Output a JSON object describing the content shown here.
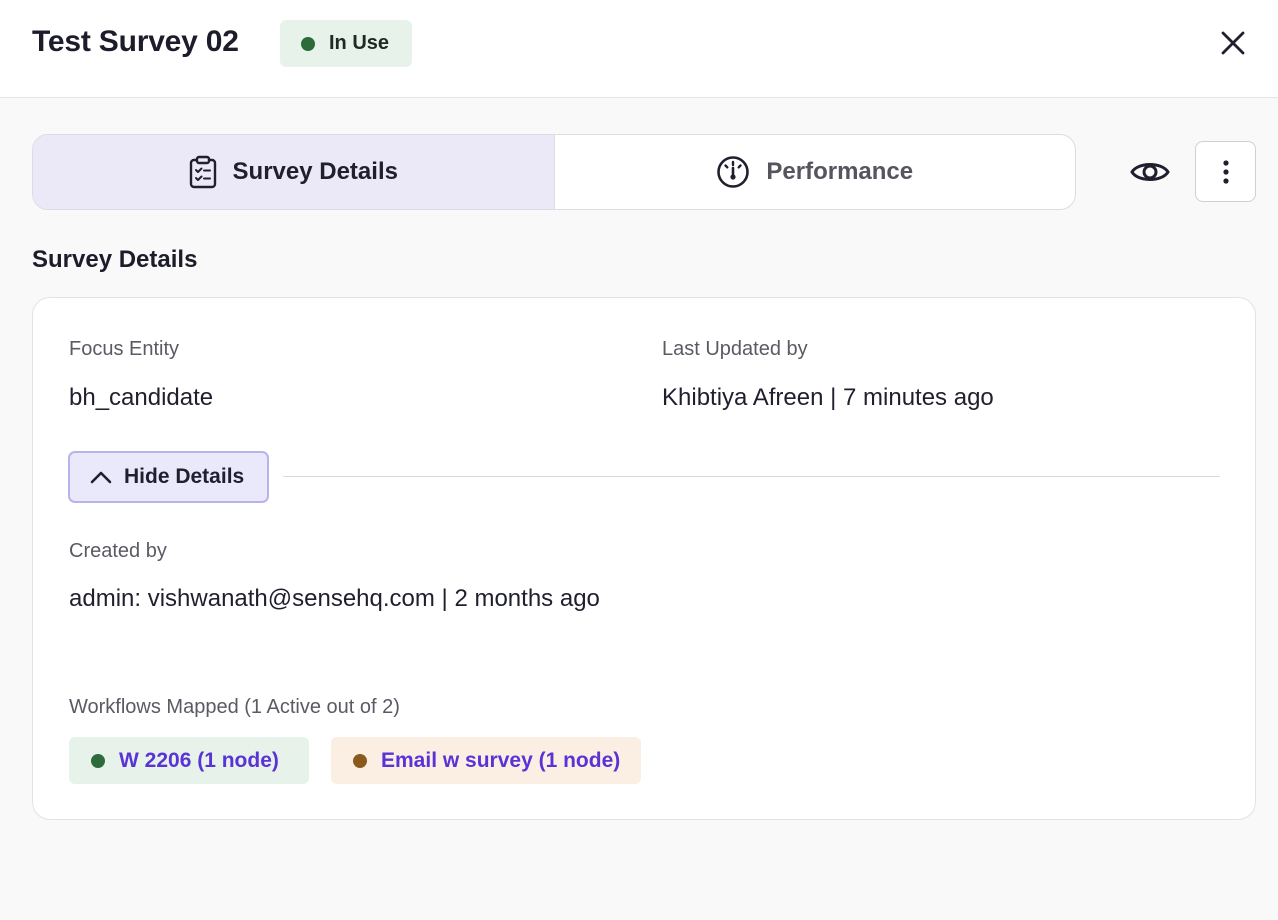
{
  "header": {
    "title": "Test Survey 02",
    "status": {
      "label": "In Use",
      "dot_color": "#2e6b3a"
    },
    "close_icon": "close-icon"
  },
  "tabs": [
    {
      "label": "Survey Details",
      "icon": "clipboard-checklist-icon",
      "active": true
    },
    {
      "label": "Performance",
      "icon": "gauge-icon",
      "active": false
    }
  ],
  "actions": {
    "preview_icon": "eye-icon",
    "more_icon": "vertical-dots-icon"
  },
  "section": {
    "title": "Survey Details"
  },
  "details": {
    "focus_entity": {
      "label": "Focus Entity",
      "value": "bh_candidate"
    },
    "last_updated": {
      "label": "Last Updated by",
      "value": "Khibtiya Afreen | 7 minutes ago"
    },
    "toggle": {
      "label": "Hide Details",
      "icon": "chevron-up-icon"
    },
    "created_by": {
      "label": "Created by",
      "value": "admin: vishwanath@sensehq.com | 2 months ago"
    },
    "workflows": {
      "label": "Workflows Mapped (1 Active out of 2)",
      "items": [
        {
          "label": "W 2206 (1 node)",
          "dot_color": "#2e6b3a",
          "bg": "#e7f3ea"
        },
        {
          "label": "Email w survey (1 node)",
          "dot_color": "#8a5a1c",
          "bg": "#fbefe4"
        }
      ]
    }
  },
  "colors": {
    "accent": "#5a33d6",
    "active_tab_bg": "#ebe9f7",
    "toggle_border": "#b9b2ec"
  }
}
